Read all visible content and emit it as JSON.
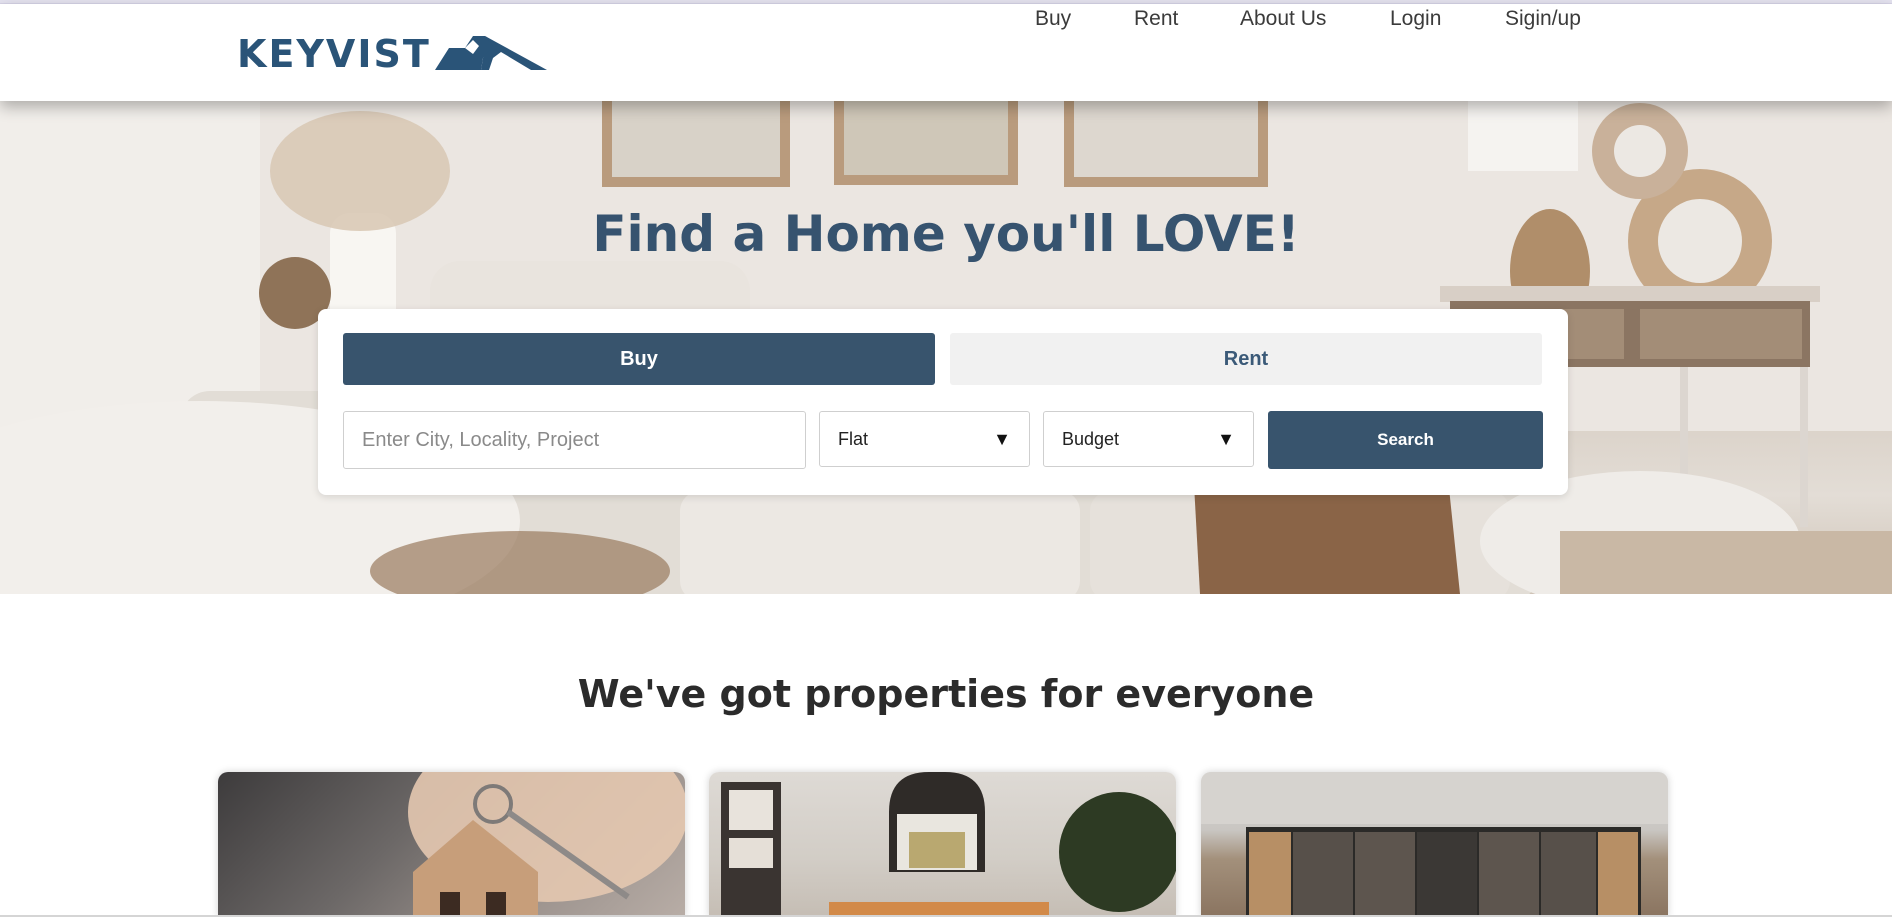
{
  "header": {
    "logo_text": "KEYVIST",
    "logo_icon": "house-roof-icon",
    "nav": [
      {
        "label": "Buy"
      },
      {
        "label": "Rent"
      },
      {
        "label": "About Us"
      },
      {
        "label": "Login"
      },
      {
        "label": "Sigin/up"
      }
    ]
  },
  "hero": {
    "title": "Find a Home you'll LOVE!",
    "tabs": {
      "buy": "Buy",
      "rent": "Rent",
      "active": "buy"
    },
    "search": {
      "placeholder": "Enter City, Locality, Project",
      "property_type": "Flat",
      "budget": "Budget",
      "button": "Search"
    }
  },
  "properties": {
    "title": "We've got properties for everyone"
  },
  "colors": {
    "brand": "#2a5478",
    "primary": "#38546d",
    "hero_title": "#36536f"
  }
}
